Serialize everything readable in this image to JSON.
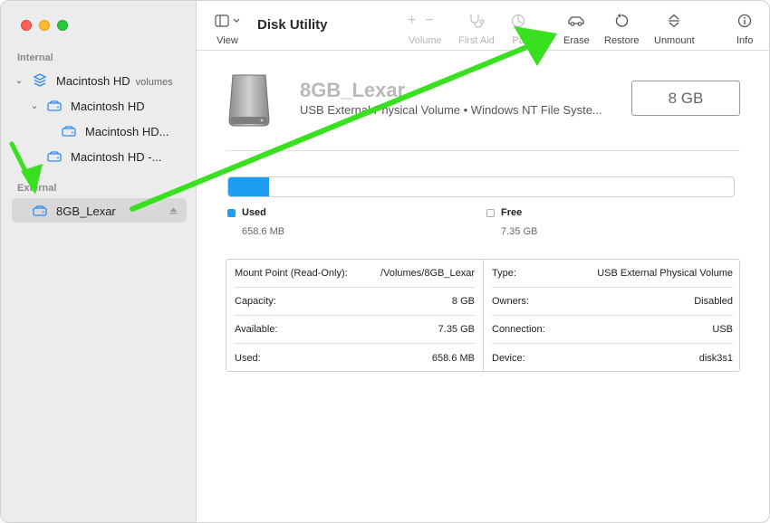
{
  "window": {
    "title": "Disk Utility",
    "controls": [
      "close",
      "minimize",
      "zoom"
    ]
  },
  "sidebar": {
    "internal_title": "Internal",
    "external_title": "External",
    "items": [
      {
        "label": "Macintosh HD",
        "sub": "volumes",
        "icon": "layers-icon",
        "expanded": true
      },
      {
        "label": "Macintosh HD",
        "icon": "drive-icon",
        "expanded": true
      },
      {
        "label": "Macintosh HD...",
        "icon": "drive-icon"
      },
      {
        "label": "Macintosh HD -...",
        "icon": "drive-icon"
      },
      {
        "label": "8GB_Lexar",
        "icon": "drive-icon",
        "selected": true,
        "eject": true
      }
    ]
  },
  "toolbar": {
    "view": "View",
    "volume": "Volume",
    "first_aid": "First Aid",
    "partition": "Pa",
    "erase": "Erase",
    "restore": "Restore",
    "unmount": "Unmount",
    "info": "Info"
  },
  "disk": {
    "name": "8GB_Lexar",
    "description": "USB External Physical Volume • Windows NT File Syste...",
    "size": "8 GB"
  },
  "usage": {
    "used_fraction": 0.08,
    "used_label": "Used",
    "used_value": "658.6 MB",
    "free_label": "Free",
    "free_value": "7.35 GB",
    "used_color": "#1e9ef3"
  },
  "info": {
    "left": [
      {
        "k": "Mount Point (Read-Only):",
        "v": "/Volumes/8GB_Lexar"
      },
      {
        "k": "Capacity:",
        "v": "8 GB"
      },
      {
        "k": "Available:",
        "v": "7.35 GB"
      },
      {
        "k": "Used:",
        "v": "658.6 MB"
      }
    ],
    "right": [
      {
        "k": "Type:",
        "v": "USB External Physical Volume"
      },
      {
        "k": "Owners:",
        "v": "Disabled"
      },
      {
        "k": "Connection:",
        "v": "USB"
      },
      {
        "k": "Device:",
        "v": "disk3s1"
      }
    ]
  },
  "annotation": {
    "arrow_color": "#39e01f"
  }
}
